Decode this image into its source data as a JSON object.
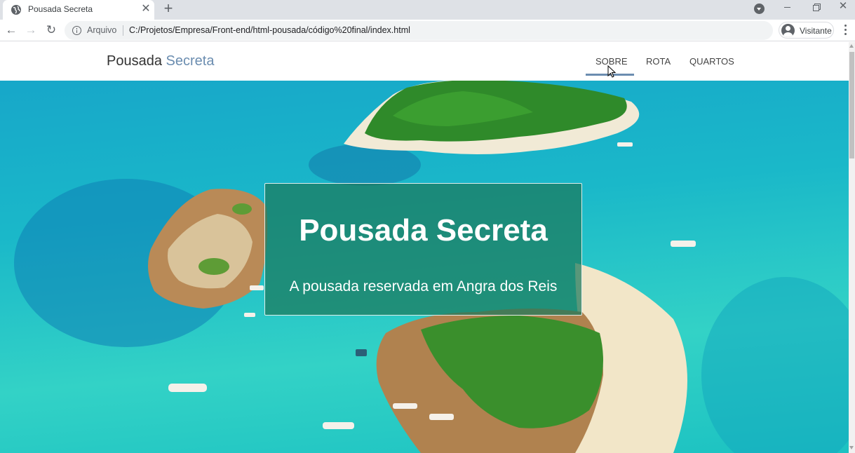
{
  "browser": {
    "tab": {
      "title": "Pousada Secreta",
      "close_label": "✕"
    },
    "new_tab_label": "+",
    "address": {
      "scheme_label": "Arquivo",
      "url": "C:/Projetos/Empresa/Front-end/html-pousada/código%20final/index.html"
    },
    "profile_label": "Visitante",
    "window": {
      "close_label": "✕"
    },
    "nav": {
      "back": "←",
      "forward": "→",
      "reload": "↻"
    }
  },
  "site": {
    "brand": {
      "part1": "Pousada",
      "part2": "Secreta"
    },
    "menu": [
      {
        "label": "SOBRE",
        "active": true
      },
      {
        "label": "ROTA",
        "active": false
      },
      {
        "label": "QUARTOS",
        "active": false
      }
    ],
    "hero": {
      "title": "Pousada Secreta",
      "subtitle": "A pousada reservada em Angra dos Reis"
    }
  },
  "colors": {
    "brand_accent": "#6b8db0",
    "card_overlay": "#1c785c",
    "water": "#1ab8c9"
  },
  "icons": [
    "globe-icon",
    "info-icon",
    "profile-icon",
    "menu-kebab-icon",
    "tab-search-icon"
  ]
}
